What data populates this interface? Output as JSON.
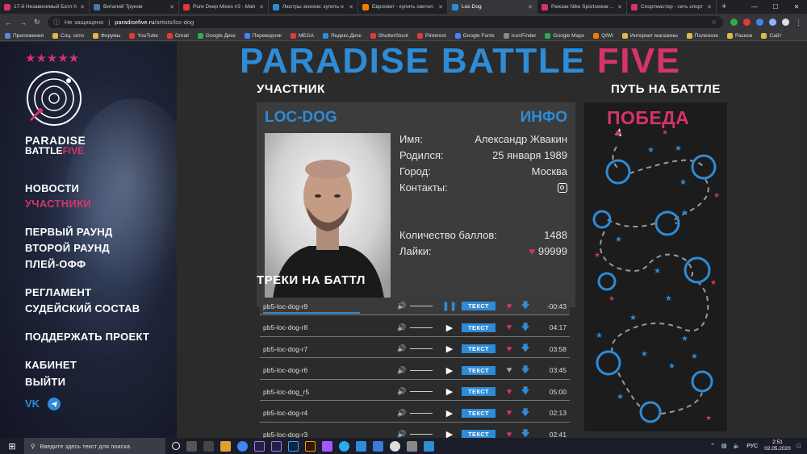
{
  "browser": {
    "tabs": [
      {
        "title": "17-й Независимый Батл h",
        "color": "#d6336c",
        "active": false
      },
      {
        "title": "Виталий Трунов",
        "color": "#4a76a8",
        "active": false
      },
      {
        "title": "Pure Deep Mixes #3 - Mah",
        "color": "#e53935",
        "active": false
      },
      {
        "title": "Люстры эконом: купить н",
        "color": "#2e8bd6",
        "active": false
      },
      {
        "title": "Евросвет - купить светил",
        "color": "#f57c00",
        "active": false
      },
      {
        "title": "Loc-Dog",
        "color": "#2e8bd6",
        "active": true
      },
      {
        "title": "Рюкзак Nike Sportswear El",
        "color": "#d6336c",
        "active": false
      },
      {
        "title": "Спортмастер - сеть спорт",
        "color": "#d6336c",
        "active": false
      }
    ],
    "address": {
      "security": "Не защищено",
      "domain": "paradisefive.ru",
      "path": "/artists/loc-dog"
    },
    "bookmarks": [
      {
        "label": "Приложения",
        "color": "#5f86d6"
      },
      {
        "label": "Соц. сети",
        "color": "#e0b84a"
      },
      {
        "label": "Форумы",
        "color": "#e0b84a"
      },
      {
        "label": "YouTube",
        "color": "#e53935"
      },
      {
        "label": "Gmail",
        "color": "#e53935"
      },
      {
        "label": "Google Диск",
        "color": "#34a853"
      },
      {
        "label": "Переводчик",
        "color": "#4285f4"
      },
      {
        "label": "MEGA",
        "color": "#e53935"
      },
      {
        "label": "Яндекс.Диск",
        "color": "#2e8bd6"
      },
      {
        "label": "ShutterStock",
        "color": "#e53935"
      },
      {
        "label": "Pinterest",
        "color": "#e53935"
      },
      {
        "label": "Google Fonts",
        "color": "#4285f4"
      },
      {
        "label": "IconFinder",
        "color": "#888888"
      },
      {
        "label": "Google Maps",
        "color": "#34a853"
      },
      {
        "label": "QIWI",
        "color": "#f57c00"
      },
      {
        "label": "Интернет магазины",
        "color": "#e0b84a"
      },
      {
        "label": "Полезное",
        "color": "#e0b84a"
      },
      {
        "label": "Разное",
        "color": "#e0b84a"
      },
      {
        "label": "Сайт",
        "color": "#e0b84a"
      }
    ]
  },
  "site": {
    "title_blue": "PARADISE BATTLE",
    "title_pink": "FIVE",
    "stars": "★★★★★",
    "logo_line1": "PARADISE",
    "logo_line2_a": "BATTLE",
    "logo_line2_b": "FIVE",
    "nav": [
      {
        "label": "НОВОСТИ",
        "active": false
      },
      {
        "label": "УЧАСТНИКИ",
        "active": true
      },
      {
        "label": "ПЕРВЫЙ РАУНД",
        "active": false
      },
      {
        "label": "ВТОРОЙ РАУНД",
        "active": false
      },
      {
        "label": "ПЛЕЙ-ОФФ",
        "active": false
      },
      {
        "label": "РЕГЛАМЕНТ",
        "active": false
      },
      {
        "label": "СУДЕЙСКИЙ СОСТАВ",
        "active": false
      },
      {
        "label": "ПОДДЕРЖАТЬ ПРОЕКТ",
        "active": false
      },
      {
        "label": "КАБИНЕТ",
        "active": false
      },
      {
        "label": "ВЫЙТИ",
        "active": false
      }
    ],
    "socials": {
      "vk": "VK",
      "tg_icon": "telegram-icon"
    }
  },
  "participant": {
    "section_title": "УЧАСТНИК",
    "name": "LOC-DOG",
    "info_label": "ИНФО",
    "fields": [
      {
        "label": "Имя:",
        "value": "Александр Жвакин"
      },
      {
        "label": "Родился:",
        "value": "25 января 1989"
      },
      {
        "label": "Город:",
        "value": "Москва"
      },
      {
        "label": "Контакты:",
        "value": ""
      }
    ],
    "score_label": "Количество баллов:",
    "score": "1488",
    "likes_label": "Лайки:",
    "likes": "99999"
  },
  "tracks": {
    "section_title": "ТРЕКИ НА БАТТЛ",
    "button_label": "ТЕКСТ",
    "items": [
      {
        "name": "pb5-loc-dog-r9",
        "duration": "-00:43",
        "playing": true,
        "liked": true,
        "progress": 0.4
      },
      {
        "name": "pb5-loc-dog-r8",
        "duration": "04:17",
        "playing": false,
        "liked": true
      },
      {
        "name": "pb5-loc-dog-r7",
        "duration": "03:58",
        "playing": false,
        "liked": true
      },
      {
        "name": "pb5-loc-dog-r6",
        "duration": "03:45",
        "playing": false,
        "liked": false
      },
      {
        "name": "pb5-loc-dog_r5",
        "duration": "05:00",
        "playing": false,
        "liked": true
      },
      {
        "name": "pb5-loc-dog-r4",
        "duration": "02:13",
        "playing": false,
        "liked": true
      },
      {
        "name": "pb5-loc-dog-r3",
        "duration": "02:41",
        "playing": false,
        "liked": true
      }
    ]
  },
  "battle_path": {
    "section_title": "ПУТЬ НА БАТТЛЕ",
    "victory": "ПОБЕДА"
  },
  "taskbar": {
    "search_placeholder": "Введите здесь текст для поиска",
    "lang": "РУС",
    "time": "2:51",
    "date": "02.05.2020"
  }
}
